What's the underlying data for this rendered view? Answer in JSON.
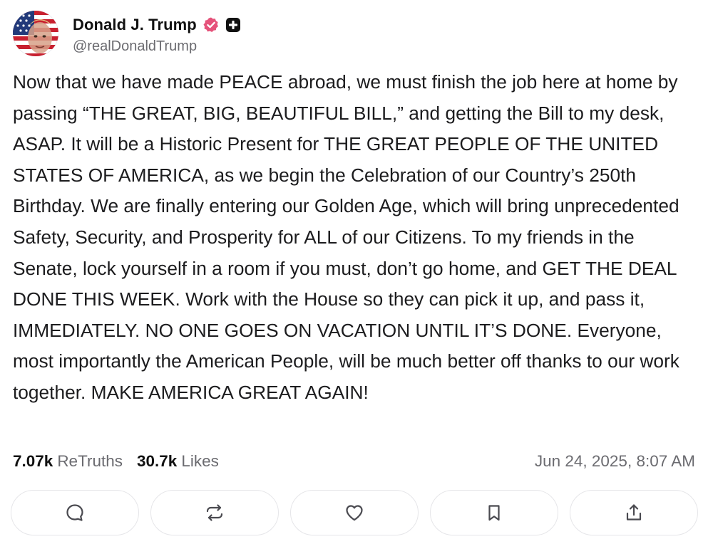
{
  "author": {
    "display_name": "Donald J. Trump",
    "handle": "@realDonaldTrump",
    "avatar_icon": "flag-portrait-avatar",
    "verified_icon": "verified-badge-icon",
    "verified_color": "#e5527a",
    "extra_badge_icon": "plus-badge-icon"
  },
  "post": {
    "text": "Now that we have made PEACE abroad, we must finish the job here at home by passing “THE GREAT, BIG, BEAUTIFUL BILL,” and getting the Bill to my desk, ASAP. It will be a Historic Present for THE GREAT PEOPLE OF THE UNITED STATES OF AMERICA, as we begin the Celebration of our Country’s 250th Birthday. We are finally entering our Golden Age, which will bring unprecedented Safety, Security, and Prosperity for ALL of our Citizens. To my friends in the Senate, lock yourself in a room if you must, don’t go home, and GET THE DEAL DONE THIS WEEK. Work with the House so they can pick it up, and pass it, IMMEDIATELY. NO ONE GOES ON VACATION UNTIL IT’S DONE. Everyone, most importantly the American People, will be much better off thanks to our work together. MAKE AMERICA GREAT AGAIN!"
  },
  "stats": {
    "retruths_count": "7.07k",
    "retruths_label": "ReTruths",
    "likes_count": "30.7k",
    "likes_label": "Likes",
    "timestamp": "Jun 24, 2025, 8:07 AM"
  },
  "actions": [
    {
      "icon": "reply-icon"
    },
    {
      "icon": "retruth-icon"
    },
    {
      "icon": "like-icon"
    },
    {
      "icon": "bookmark-icon"
    },
    {
      "icon": "share-icon"
    }
  ],
  "colors": {
    "text": "#1c1c1e",
    "muted": "#6b6b70",
    "button_border": "#e6e6e9"
  }
}
